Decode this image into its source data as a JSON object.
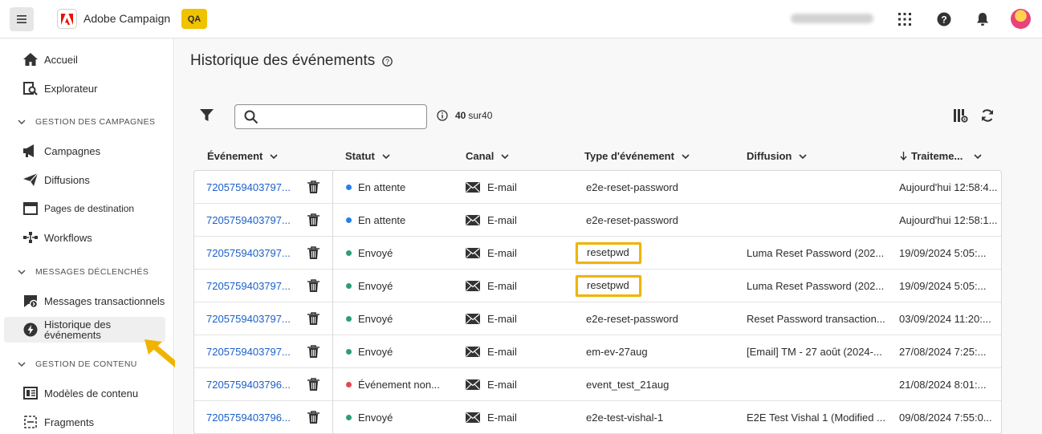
{
  "app": {
    "name": "Adobe Campaign",
    "env_badge": "QA",
    "accent": "#eb1000"
  },
  "sidebar": {
    "items": [
      {
        "label": "Accueil"
      },
      {
        "label": "Explorateur"
      }
    ],
    "sections": [
      {
        "title": "GESTION DES CAMPAGNES",
        "items": [
          {
            "label": "Campagnes"
          },
          {
            "label": "Diffusions"
          },
          {
            "label": "Pages de destination"
          },
          {
            "label": "Workflows"
          }
        ]
      },
      {
        "title": "MESSAGES DÉCLENCHÉS",
        "items": [
          {
            "label": "Messages transactionnels"
          },
          {
            "label": "Historique des événements",
            "active": true
          }
        ]
      },
      {
        "title": "GESTION DE CONTENU",
        "items": [
          {
            "label": "Modèles de contenu"
          },
          {
            "label": "Fragments"
          }
        ]
      }
    ]
  },
  "page": {
    "title": "Historique des événements",
    "count_value": "40",
    "count_suffix": "sur40",
    "search_placeholder": ""
  },
  "table": {
    "columns": [
      "Événement",
      "Statut",
      "Canal",
      "Type d'événement",
      "Diffusion",
      "Traiteme..."
    ],
    "rows": [
      {
        "event": "7205759403797...",
        "status": "En attente",
        "status_color": "#2680eb",
        "channel": "E-mail",
        "type": "e2e-reset-password",
        "delivery": "",
        "processed": "Aujourd'hui 12:58:4...",
        "highlight": false
      },
      {
        "event": "7205759403797...",
        "status": "En attente",
        "status_color": "#2680eb",
        "channel": "E-mail",
        "type": "e2e-reset-password",
        "delivery": "",
        "processed": "Aujourd'hui 12:58:1...",
        "highlight": false
      },
      {
        "event": "7205759403797...",
        "status": "Envoyé",
        "status_color": "#2d9d78",
        "channel": "E-mail",
        "type": "resetpwd",
        "delivery": "Luma Reset Password (202...",
        "processed": "19/09/2024  5:05:...",
        "highlight": true
      },
      {
        "event": "7205759403797...",
        "status": "Envoyé",
        "status_color": "#2d9d78",
        "channel": "E-mail",
        "type": "resetpwd",
        "delivery": "Luma Reset Password (202...",
        "processed": "19/09/2024  5:05:...",
        "highlight": true
      },
      {
        "event": "7205759403797...",
        "status": "Envoyé",
        "status_color": "#2d9d78",
        "channel": "E-mail",
        "type": "e2e-reset-password",
        "delivery": "Reset Password transaction...",
        "processed": "03/09/2024 11:20:...",
        "highlight": false
      },
      {
        "event": "7205759403797...",
        "status": "Envoyé",
        "status_color": "#2d9d78",
        "channel": "E-mail",
        "type": "em-ev-27aug",
        "delivery": "[Email] TM - 27 août (2024-...",
        "processed": "27/08/2024  7:25:...",
        "highlight": false
      },
      {
        "event": "7205759403796...",
        "status": "Événement non...",
        "status_color": "#e34850",
        "channel": "E-mail",
        "type": "event_test_21aug",
        "delivery": "",
        "processed": "21/08/2024  8:01:...",
        "highlight": false
      },
      {
        "event": "7205759403796...",
        "status": "Envoyé",
        "status_color": "#2d9d78",
        "channel": "E-mail",
        "type": "e2e-test-vishal-1",
        "delivery": "E2E Test Vishal 1 (Modified ...",
        "processed": "09/08/2024  7:55:0...",
        "highlight": false
      }
    ]
  }
}
